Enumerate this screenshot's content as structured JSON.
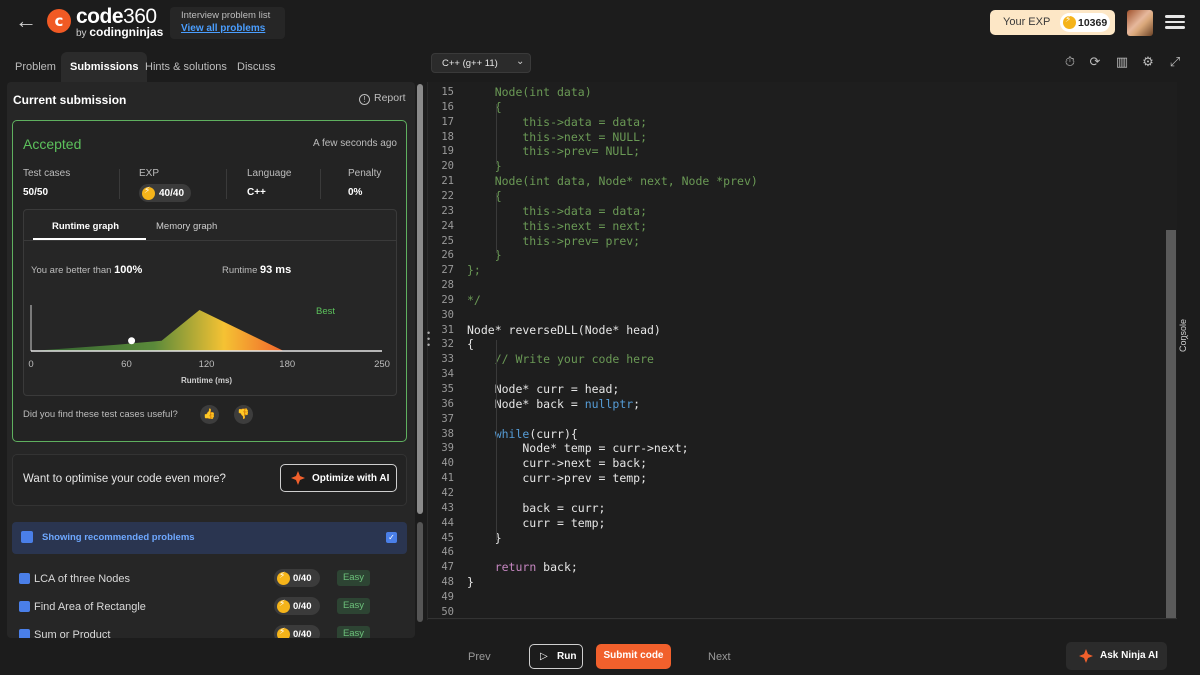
{
  "header": {
    "logo_icon": "c",
    "logo_code": "code",
    "logo_num": "360",
    "logo_by": "by",
    "logo_brand": "codingninjas",
    "problem_list_title": "Interview problem list",
    "problem_list_link": "View all problems",
    "exp_label": "Your EXP",
    "exp_value": "10369"
  },
  "tabs": [
    {
      "label": "Problem"
    },
    {
      "label": "Submissions",
      "active": true
    },
    {
      "label": "Hints & solutions"
    },
    {
      "label": "Discuss"
    }
  ],
  "submission": {
    "title": "Current submission",
    "report": "Report",
    "status": "Accepted",
    "time": "A few seconds ago",
    "stats": [
      {
        "label": "Test cases",
        "value": "50/50"
      },
      {
        "label": "EXP",
        "value": "40/40"
      },
      {
        "label": "Language",
        "value": "C++"
      },
      {
        "label": "Penalty",
        "value": "0%"
      }
    ],
    "graph_tabs": [
      "Runtime graph",
      "Memory graph"
    ],
    "better_label": "You are better than",
    "better_value": "100%",
    "runtime_label": "Runtime",
    "runtime_value": "93 ms",
    "useful_question": "Did you find these test cases useful?"
  },
  "chart_data": {
    "type": "area",
    "x_ticks": [
      "0",
      "60",
      "120",
      "180",
      "250"
    ],
    "xlabel": "Runtime (ms)",
    "xlim": [
      0,
      250
    ],
    "legend": "Best",
    "marker_x": 93,
    "series": [
      {
        "x": [
          0,
          60,
          93,
          120,
          180,
          250
        ],
        "y": [
          0,
          0.15,
          0.25,
          1.0,
          0,
          0
        ]
      }
    ],
    "colors": {
      "low": "#3c7a3c",
      "mid": "#f5c233",
      "high": "#f0542a"
    }
  },
  "optimize": {
    "question": "Want to optimise your code even more?",
    "button": "Optimize with AI"
  },
  "recommended": {
    "header": "Showing recommended problems",
    "items": [
      {
        "name": "LCA of three Nodes",
        "exp": "0/40",
        "difficulty": "Easy"
      },
      {
        "name": "Find Area of Rectangle",
        "exp": "0/40",
        "difficulty": "Easy"
      },
      {
        "name": "Sum or Product",
        "exp": "0/40",
        "difficulty": "Easy"
      }
    ]
  },
  "editor": {
    "language": "C++ (g++ 11)",
    "lines": [
      {
        "n": "15",
        "t": "    Node(int data)",
        "c": "cm"
      },
      {
        "n": "16",
        "t": "    {",
        "c": "cm"
      },
      {
        "n": "17",
        "t": "        this->data = data;",
        "c": "cm"
      },
      {
        "n": "18",
        "t": "        this->next = NULL;",
        "c": "cm"
      },
      {
        "n": "19",
        "t": "        this->prev= NULL;",
        "c": "cm"
      },
      {
        "n": "20",
        "t": "    }",
        "c": "cm"
      },
      {
        "n": "21",
        "t": "    Node(int data, Node* next, Node *prev)",
        "c": "cm"
      },
      {
        "n": "22",
        "t": "    {",
        "c": "cm"
      },
      {
        "n": "23",
        "t": "        this->data = data;",
        "c": "cm"
      },
      {
        "n": "24",
        "t": "        this->next = next;",
        "c": "cm"
      },
      {
        "n": "25",
        "t": "        this->prev= prev;",
        "c": "cm"
      },
      {
        "n": "26",
        "t": "    }",
        "c": "cm"
      },
      {
        "n": "27",
        "t": "};",
        "c": "cm"
      },
      {
        "n": "28",
        "t": "",
        "c": ""
      },
      {
        "n": "29",
        "t": "*/",
        "c": "cm"
      },
      {
        "n": "30",
        "t": "",
        "c": ""
      },
      {
        "n": "31",
        "t": "Node* reverseDLL(Node* head)",
        "c": ""
      },
      {
        "n": "32",
        "t": "{",
        "c": ""
      },
      {
        "n": "33",
        "t": "    // Write your code here",
        "c": "cm"
      },
      {
        "n": "34",
        "t": "",
        "c": ""
      },
      {
        "n": "35",
        "t": "    Node* curr = head;",
        "c": ""
      },
      {
        "n": "36",
        "t": "    Node* back = nullptr;",
        "c": "np"
      },
      {
        "n": "37",
        "t": "",
        "c": ""
      },
      {
        "n": "38",
        "t": "    while(curr){",
        "c": "wh"
      },
      {
        "n": "39",
        "t": "        Node* temp = curr->next;",
        "c": ""
      },
      {
        "n": "40",
        "t": "        curr->next = back;",
        "c": ""
      },
      {
        "n": "41",
        "t": "        curr->prev = temp;",
        "c": ""
      },
      {
        "n": "42",
        "t": "",
        "c": ""
      },
      {
        "n": "43",
        "t": "        back = curr;",
        "c": ""
      },
      {
        "n": "44",
        "t": "        curr = temp;",
        "c": ""
      },
      {
        "n": "45",
        "t": "    }",
        "c": ""
      },
      {
        "n": "46",
        "t": "",
        "c": ""
      },
      {
        "n": "47",
        "t": "    return back;",
        "c": "rt"
      },
      {
        "n": "48",
        "t": "}",
        "c": ""
      },
      {
        "n": "49",
        "t": "",
        "c": ""
      },
      {
        "n": "50",
        "t": "",
        "c": ""
      }
    ]
  },
  "console_label": "Console",
  "bottom": {
    "prev": "Prev",
    "run": "Run",
    "submit": "Submit code",
    "next": "Next",
    "ask_ai": "Ask Ninja AI"
  }
}
